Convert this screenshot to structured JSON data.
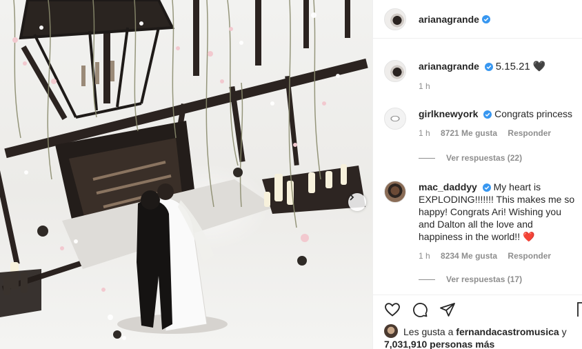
{
  "post": {
    "author": "arianagrande",
    "caption": "5.15.21 🖤"
  },
  "comments": [
    {
      "username": "arianagrande",
      "text": "5.15.21 🖤",
      "time": "1 h"
    },
    {
      "username": "girlknewyork",
      "text": "Congrats princess",
      "time": "1 h",
      "likes": "8721 Me gusta",
      "reply_label": "Responder",
      "view_replies": "Ver respuestas (22)"
    },
    {
      "username": "mac_daddyy",
      "text": "My heart is EXPLODING!!!!!!! This makes me so happy! Congrats Ari! Wishing you and Dalton all the love and happiness in the world!! ❤️",
      "time": "1 h",
      "likes": "8234 Me gusta",
      "reply_label": "Responder",
      "view_replies": "Ver respuestas (17)"
    }
  ],
  "likes_summary": {
    "prefix": "Les gusta a",
    "user": "fernandacastromusica",
    "connector": "y",
    "others": "7,031,910 personas más"
  },
  "icons": [
    "heart-icon",
    "comment-icon",
    "share-icon",
    "save-icon",
    "verified-badge-icon",
    "next-arrow-icon"
  ],
  "colors": {
    "verified": "#3897f0",
    "muted": "#8e8e8e",
    "text": "#262626"
  }
}
